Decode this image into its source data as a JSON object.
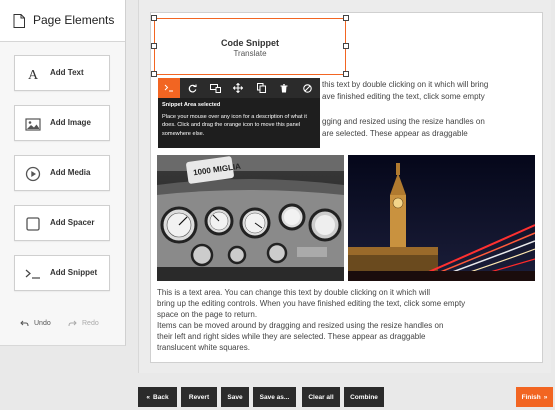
{
  "sidebar": {
    "title": "Page Elements",
    "items": [
      {
        "label": "Add Text",
        "icon": "text-icon"
      },
      {
        "label": "Add Image",
        "icon": "image-icon"
      },
      {
        "label": "Add Media",
        "icon": "play-icon"
      },
      {
        "label": "Add Spacer",
        "icon": "square-icon"
      },
      {
        "label": "Add Snippet",
        "icon": "terminal-icon"
      }
    ],
    "undo_label": "Undo",
    "redo_label": "Redo"
  },
  "canvas": {
    "top_text": {
      "line1": "this text by double clicking on it which will bring",
      "line2": "ave finished editing the text, click some empty",
      "line3": "gging and resized using the resize handles on",
      "line4": "are selected. These appear as draggable"
    },
    "snippet": {
      "title": "Code Snippet",
      "subtitle": "Translate"
    },
    "tooltip": {
      "title": "Snippet Area selected",
      "body": "Place your mouse over any icon for a description of what it does. Click and drag the orange icon to move this panel somewhere else."
    },
    "bottom_text": [
      "This is a text area. You can change this text by double clicking on it which will",
      "bring up the editing controls. When you have finished editing the text, click some empty",
      "space on the page to return.",
      "Items can be moved around by dragging and resized using the resize handles on",
      "their left and right sides while they are selected. These appear as draggable",
      "translucent white squares."
    ],
    "photo_left_plate": "1000 MIGLIA"
  },
  "toolbar": {
    "icons": [
      "terminal-icon",
      "refresh-icon",
      "display-icon",
      "move-icon",
      "copy-icon",
      "trash-icon",
      "cancel-icon"
    ]
  },
  "bottom_bar": {
    "back": "Back",
    "revert": "Revert",
    "save": "Save",
    "save_as": "Save as...",
    "clear_all": "Clear all",
    "combine": "Combine",
    "finish": "Finish"
  },
  "colors": {
    "accent": "#f26522",
    "dark": "#2b2b2b"
  }
}
